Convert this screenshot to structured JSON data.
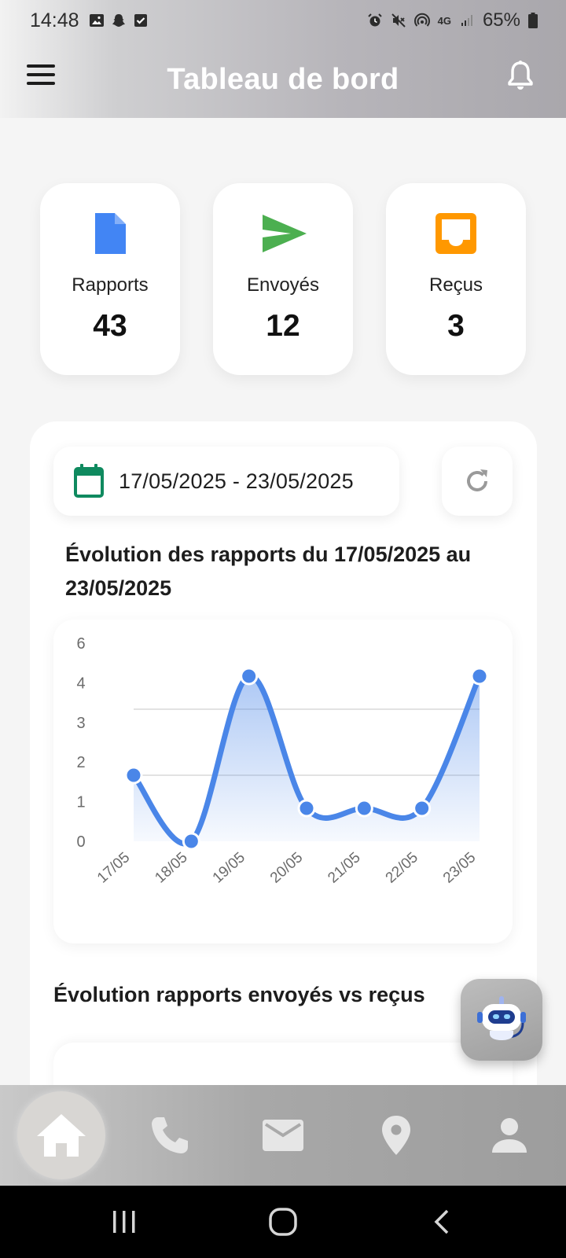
{
  "status_bar": {
    "time": "14:48",
    "network": "4G",
    "battery": "65%",
    "left_icons": [
      "image-icon",
      "snapchat-icon",
      "checkbox-icon"
    ],
    "right_icons": [
      "alarm-icon",
      "mute-icon",
      "hotspot-icon",
      "signal-icon",
      "battery-icon"
    ]
  },
  "header": {
    "title": "Tableau de bord",
    "menu_icon": "menu-icon",
    "bell_icon": "bell-icon"
  },
  "stats": [
    {
      "label": "Rapports",
      "value": "43",
      "icon": "document-icon",
      "color": "#4285f4"
    },
    {
      "label": "Envoyés",
      "value": "12",
      "icon": "send-icon",
      "color": "#4caf50"
    },
    {
      "label": "Reçus",
      "value": "3",
      "icon": "inbox-icon",
      "color": "#ff9800"
    }
  ],
  "filter": {
    "date_range": "17/05/2025 - 23/05/2025",
    "calendar_icon": "calendar-icon",
    "calendar_color": "#0f8a5f",
    "refresh_icon": "refresh-icon"
  },
  "chart_section": {
    "title": "Évolution des rapports du 17/05/2025 au 23/05/2025"
  },
  "chart_data": {
    "type": "area",
    "title": "Évolution des rapports du 17/05/2025 au 23/05/2025",
    "categories": [
      "17/05",
      "18/05",
      "19/05",
      "20/05",
      "21/05",
      "22/05",
      "23/05"
    ],
    "values": [
      2,
      0,
      5,
      1,
      1,
      1,
      5
    ],
    "y_tick_labels": [
      "0",
      "1",
      "2",
      "3",
      "4",
      "6"
    ],
    "grid_lines_at": [
      2,
      4
    ],
    "ylim": [
      0,
      6
    ],
    "xlabel": "",
    "ylabel": "",
    "line_color": "#4a86e8",
    "fill_color": "#4a86e8",
    "grid": true
  },
  "second_section": {
    "title": "Évolution rapports envoyés vs reçus"
  },
  "bot_fab": {
    "icon": "robot-icon"
  },
  "bottom_nav": {
    "items": [
      {
        "name": "home",
        "icon": "home-icon",
        "active": true
      },
      {
        "name": "phone",
        "icon": "phone-icon",
        "active": false
      },
      {
        "name": "mail",
        "icon": "mail-icon",
        "active": false
      },
      {
        "name": "location",
        "icon": "location-pin-icon",
        "active": false
      },
      {
        "name": "profile",
        "icon": "person-icon",
        "active": false
      }
    ]
  },
  "system_nav": {
    "items": [
      "recents-icon",
      "home-circle-icon",
      "back-icon"
    ]
  }
}
